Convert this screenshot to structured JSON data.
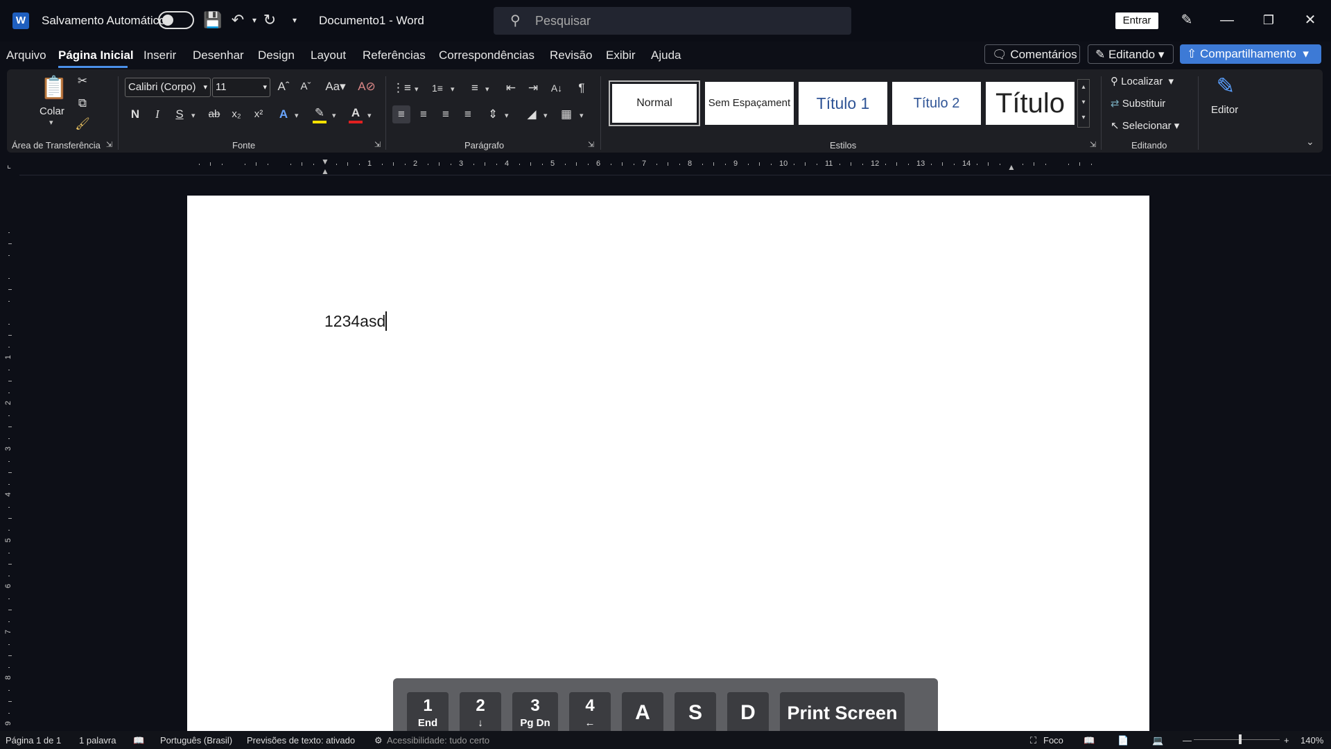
{
  "titlebar": {
    "autosave_label": "Salvamento Automático",
    "doc_title": "Documento1  -  Word",
    "search_placeholder": "Pesquisar",
    "signin": "Entrar"
  },
  "tabs": [
    "Arquivo",
    "Página Inicial",
    "Inserir",
    "Desenhar",
    "Design",
    "Layout",
    "Referências",
    "Correspondências",
    "Revisão",
    "Exibir",
    "Ajuda"
  ],
  "actions": {
    "comments": "Comentários",
    "editing": "Editando",
    "share": "Compartilhamento"
  },
  "ribbon": {
    "clipboard": {
      "paste": "Colar",
      "label": "Área de Transferência"
    },
    "font": {
      "name": "Calibri (Corpo)",
      "size": "11",
      "label": "Fonte",
      "bold": "N",
      "italic": "I",
      "underline": "S"
    },
    "paragraph": {
      "label": "Parágrafo"
    },
    "styles": {
      "label": "Estilos",
      "items": [
        "Normal",
        "Sem Espaçament",
        "Título 1",
        "Título 2",
        "Título"
      ]
    },
    "editing": {
      "label": "Editando",
      "find": "Localizar",
      "replace": "Substituir",
      "select": "Selecionar"
    },
    "editor": "Editor"
  },
  "ruler": {
    "h_numbers": [
      "1",
      "2",
      "3",
      "4",
      "5",
      "6",
      "7",
      "8",
      "9",
      "10",
      "11",
      "12",
      "13",
      "14"
    ],
    "v_numbers": [
      "1",
      "2",
      "3",
      "4",
      "5",
      "6",
      "7",
      "8",
      "9"
    ]
  },
  "document": {
    "text": "1234asd"
  },
  "osd_keys": [
    {
      "top": "1",
      "bottom": "End"
    },
    {
      "top": "2",
      "bottom": "↓"
    },
    {
      "top": "3",
      "bottom": "Pg Dn"
    },
    {
      "top": "4",
      "bottom": "←"
    },
    {
      "top": "A",
      "bottom": ""
    },
    {
      "top": "S",
      "bottom": ""
    },
    {
      "top": "D",
      "bottom": ""
    },
    {
      "top": "Print Screen",
      "bottom": ""
    }
  ],
  "status": {
    "page": "Página 1 de 1",
    "words": "1 palavra",
    "language": "Português (Brasil)",
    "predictions": "Previsões de texto: ativado",
    "accessibility": "Acessibilidade: tudo certo",
    "focus": "Foco",
    "zoom": "140%"
  },
  "colors": {
    "accent": "#3d7ad6",
    "highlight": "#f5e000",
    "font_color": "#e02020"
  }
}
